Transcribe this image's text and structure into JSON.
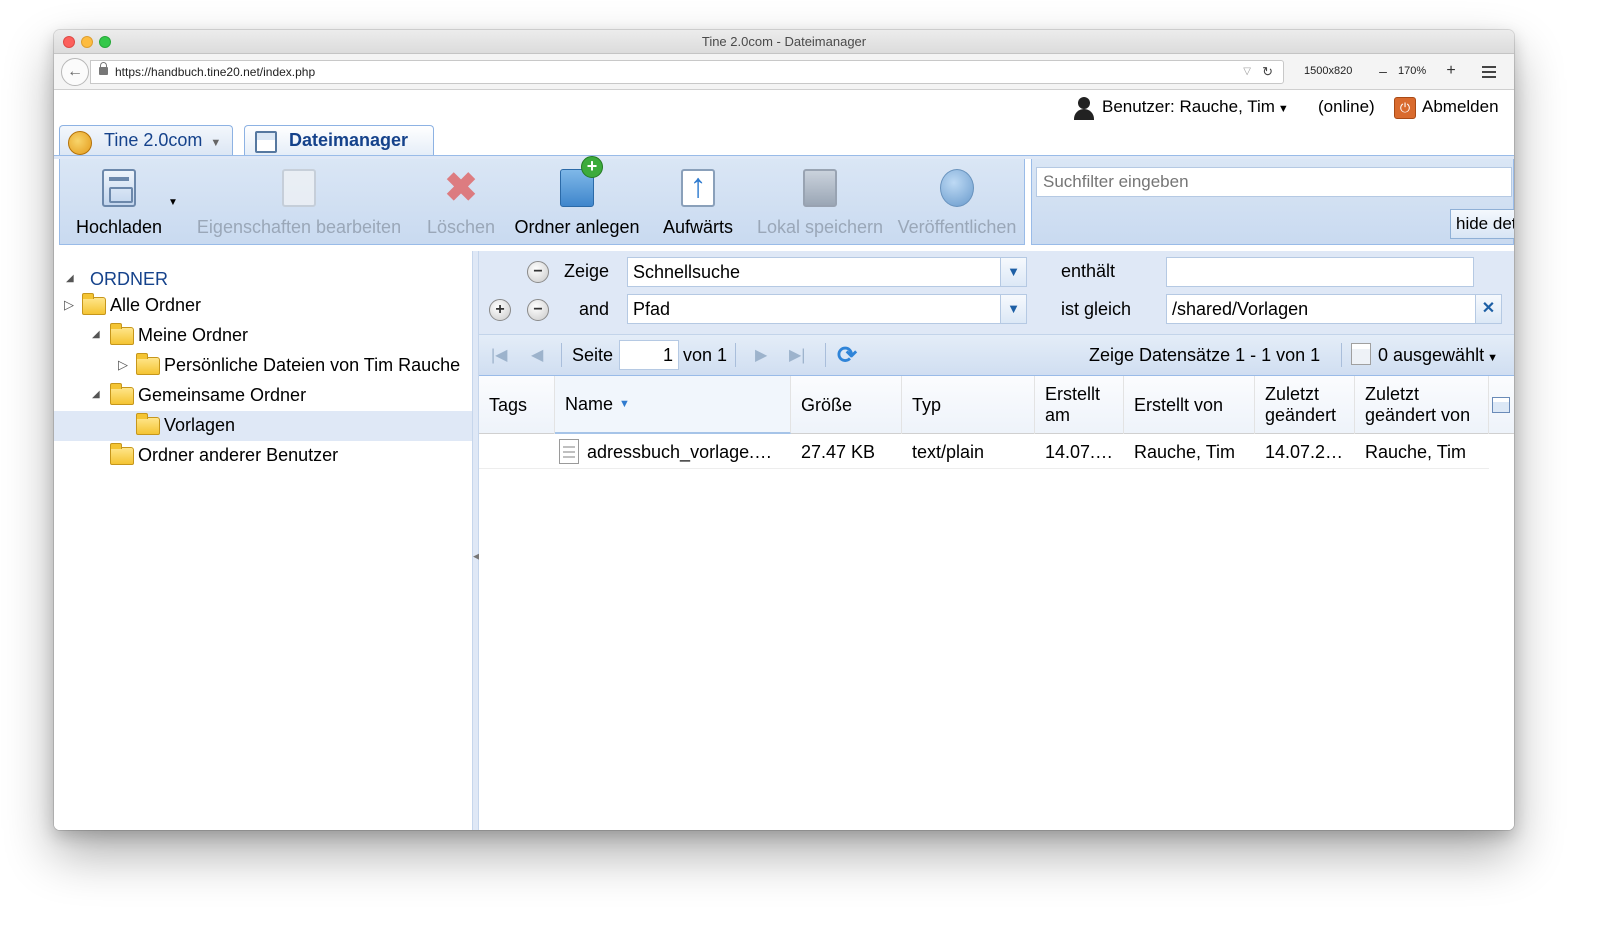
{
  "window": {
    "title": "Tine 2.0com - Dateimanager"
  },
  "browser": {
    "url": "https://handbuch.tine20.net/index.php",
    "viewport": "1500x820",
    "zoom": "170%",
    "zoom_out": "–",
    "zoom_in": "+"
  },
  "userbar": {
    "user_label": "Benutzer: Rauche, Tim",
    "status": "(online)",
    "logout": "Abmelden"
  },
  "tabs": [
    {
      "label": "Tine 2.0com"
    },
    {
      "label": "Dateimanager"
    }
  ],
  "toolbar": {
    "upload": "Hochladen",
    "edit_props": "Eigenschaften bearbeiten",
    "delete": "Löschen",
    "new_folder": "Ordner anlegen",
    "up": "Aufwärts",
    "save_local": "Lokal speichern",
    "publish": "Veröffentlichen"
  },
  "search": {
    "placeholder": "Suchfilter eingeben",
    "hide_button": "hide details"
  },
  "tree": {
    "root": "ORDNER",
    "items": [
      {
        "label": "Alle Ordner"
      },
      {
        "label": "Meine Ordner"
      },
      {
        "label": "Persönliche Dateien von Tim Rauche"
      },
      {
        "label": "Gemeinsame Ordner"
      },
      {
        "label": "Vorlagen"
      },
      {
        "label": "Ordner anderer Benutzer"
      }
    ]
  },
  "filters": [
    {
      "prefix": "Zeige",
      "field": "Schnellsuche",
      "operator": "enthält",
      "value": ""
    },
    {
      "prefix": "and",
      "field": "Pfad",
      "operator": "ist gleich",
      "value": "/shared/Vorlagen"
    }
  ],
  "paging": {
    "page_label": "Seite",
    "page": "1",
    "of_label": "von 1",
    "records": "Zeige Datensätze 1 - 1 von 1",
    "selected": "0 ausgewählt"
  },
  "grid": {
    "columns": [
      "Tags",
      "Name",
      "Größe",
      "Typ",
      "Erstellt am",
      "Erstellt von",
      "Zuletzt geändert",
      "Zuletzt geändert von"
    ],
    "rows": [
      {
        "tags": "",
        "name": "adressbuch_vorlage.…",
        "size": "27.47 KB",
        "type": "text/plain",
        "created": "14.07.…",
        "created_by": "Rauche, Tim",
        "modified": "14.07.2…",
        "modified_by": "Rauche, Tim"
      }
    ]
  }
}
